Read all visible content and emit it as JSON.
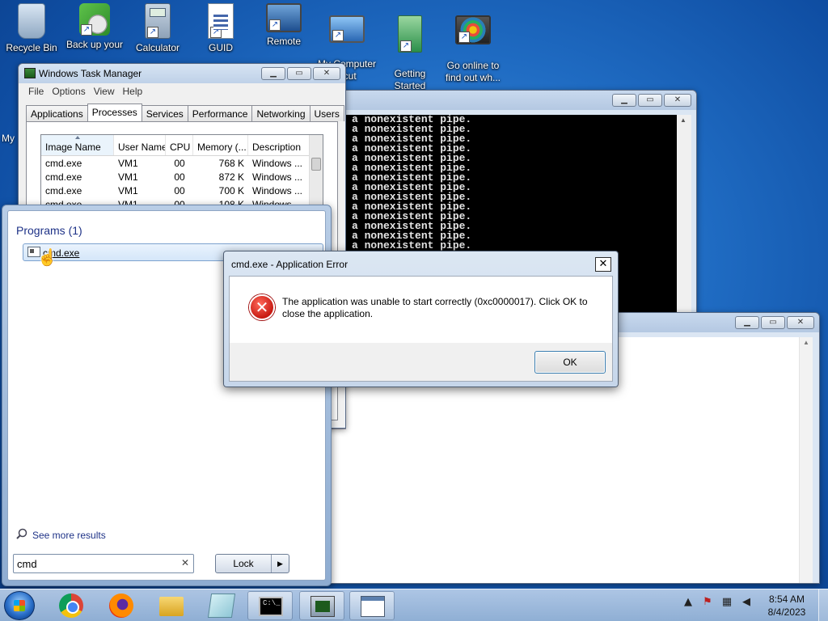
{
  "desktop": {
    "icons": [
      {
        "label": "Recycle Bin",
        "icon": "recycle-bin-icon"
      },
      {
        "label": "Back up your",
        "icon": "backup-icon"
      },
      {
        "label": "Calculator",
        "icon": "calculator-icon"
      },
      {
        "label": "GUID",
        "icon": "document-icon"
      },
      {
        "label": "Remote",
        "icon": "remote-desktop-icon"
      },
      {
        "label": "My Computer\nrtcut",
        "icon": "computer-icon"
      },
      {
        "label": "Getting\nStarted",
        "icon": "getting-started-icon"
      },
      {
        "label": "Go online to\nfind out wh...",
        "icon": "globe-icon"
      }
    ],
    "edge_label": "My"
  },
  "task_manager": {
    "title": "Windows Task Manager",
    "menu": [
      "File",
      "Options",
      "View",
      "Help"
    ],
    "tabs": [
      "Applications",
      "Processes",
      "Services",
      "Performance",
      "Networking",
      "Users"
    ],
    "active_tab": "Processes",
    "columns": [
      "Image Name",
      "User Name",
      "CPU",
      "Memory (...",
      "Description"
    ],
    "rows": [
      [
        "cmd.exe",
        "VM1",
        "00",
        "768 K",
        "Windows ..."
      ],
      [
        "cmd.exe",
        "VM1",
        "00",
        "872 K",
        "Windows ..."
      ],
      [
        "cmd.exe",
        "VM1",
        "00",
        "700 K",
        "Windows ..."
      ],
      [
        "cmd.exe",
        "VM1",
        "00",
        "108 K",
        "Windows ..."
      ]
    ]
  },
  "console": {
    "lines": [
      "a nonexistent pipe.",
      "a nonexistent pipe.",
      "a nonexistent pipe.",
      "a nonexistent pipe.",
      "a nonexistent pipe.",
      "a nonexistent pipe.",
      "a nonexistent pipe.",
      "a nonexistent pipe.",
      "a nonexistent pipe.",
      "a nonexistent pipe.",
      "a nonexistent pipe.",
      "a nonexistent pipe.",
      "a nonexistent pipe.",
      "a nonexistent pipe."
    ]
  },
  "start_menu": {
    "heading": "Programs (1)",
    "result_label": "cmd.exe",
    "see_more": "See more results",
    "search_value": "cmd",
    "clear_glyph": "✕",
    "lock_label": "Lock",
    "lock_arrow": "▶"
  },
  "error_dialog": {
    "title": "cmd.exe - Application Error",
    "message": "The application was unable to start correctly (0xc0000017). Click OK to close the application.",
    "ok_label": "OK",
    "close_glyph": "✕"
  },
  "window_buttons": {
    "minimize": "▁",
    "maximize": "▭",
    "close": "✕"
  },
  "taskbar": {
    "clock_time": "8:54 AM",
    "clock_date": "8/4/2023",
    "cmd_icon_text": "C:\\_",
    "tray_icons": [
      "show-hidden-icon",
      "action-center-icon",
      "network-icon",
      "volume-muted-icon"
    ],
    "tray_glyphs": [
      "▲",
      "⚑",
      "▦",
      "◀"
    ]
  }
}
